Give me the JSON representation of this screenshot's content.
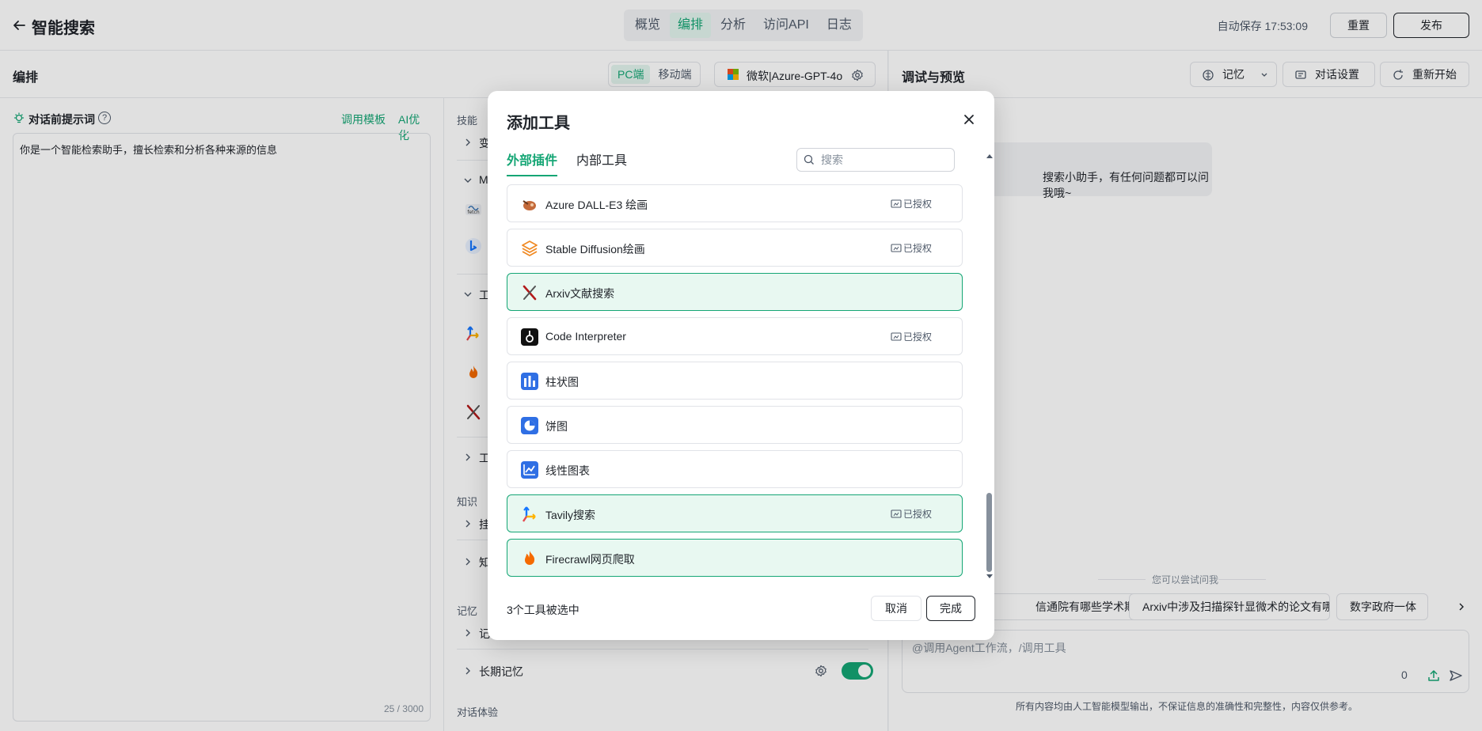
{
  "header": {
    "title": "智能搜索",
    "nav_tabs": [
      {
        "label": "概览"
      },
      {
        "label": "编排"
      },
      {
        "label": "分析"
      },
      {
        "label": "访问API"
      },
      {
        "label": "日志"
      }
    ],
    "active_tab": "编排",
    "autosave": "自动保存 17:53:09",
    "reset_label": "重置",
    "publish_label": "发布"
  },
  "editor": {
    "title": "编排",
    "device_pc": "PC端",
    "device_mobile": "移动端",
    "model_name": "微软|Azure-GPT-4o",
    "prompt_label": "对话前提示词",
    "template_link": "调用模板",
    "ai_optimize_link": "AI优化",
    "prompt_text": "你是一个智能检索助手，擅长检索和分析各种来源的信息",
    "char_count": "25 / 3000"
  },
  "skills": {
    "section_skills": "技能",
    "row_variables": "变",
    "row_mcp": "MC",
    "row_tools": "工",
    "row_workflow": "工",
    "section_knowledge": "知识",
    "row_mount": "挂",
    "row_knowledge": "知",
    "section_memory": "记忆",
    "row_memory_vars": "记忆变量",
    "row_long_memory": "长期记忆",
    "section_experience": "对话体验"
  },
  "preview": {
    "title": "调试与预览",
    "memory_btn": "记忆",
    "dialog_settings_btn": "对话设置",
    "restart_btn": "重新开始",
    "greeting": "搜索小助手，有任何问题都可以问我哦~",
    "try_label": "您可以尝试问我",
    "suggestions": [
      {
        "label": "信通院有哪些学术期刊?"
      },
      {
        "label": "Arxiv中涉及扫描探针显微术的论文有哪些?"
      },
      {
        "label": "数字政府一体"
      }
    ],
    "input_placeholder": "@调用Agent工作流，/调用工具",
    "input_count": "0",
    "disclaimer": "所有内容均由人工智能模型输出，不保证信息的准确性和完整性，内容仅供参考。"
  },
  "modal": {
    "title": "添加工具",
    "tab_external": "外部插件",
    "tab_internal": "内部工具",
    "search_placeholder": "搜索",
    "authorized_label": "已授权",
    "plugins": [
      {
        "name": "Azure DALL-E3 绘画",
        "icon": "dalle-icon",
        "authorized": true,
        "selected": false
      },
      {
        "name": "Stable Diffusion绘画",
        "icon": "stable-diffusion-icon",
        "authorized": true,
        "selected": false
      },
      {
        "name": "Arxiv文献搜索",
        "icon": "arxiv-icon",
        "authorized": false,
        "selected": true
      },
      {
        "name": "Code Interpreter",
        "icon": "code-interpreter-icon",
        "authorized": true,
        "selected": false
      },
      {
        "name": "柱状图",
        "icon": "bar-chart-icon",
        "authorized": false,
        "selected": false
      },
      {
        "name": "饼图",
        "icon": "pie-chart-icon",
        "authorized": false,
        "selected": false
      },
      {
        "name": "线性图表",
        "icon": "line-chart-icon",
        "authorized": false,
        "selected": false
      },
      {
        "name": "Tavily搜索",
        "icon": "tavily-icon",
        "authorized": true,
        "selected": true
      },
      {
        "name": "Firecrawl网页爬取",
        "icon": "firecrawl-icon",
        "authorized": false,
        "selected": true
      }
    ],
    "selected_count_text": "3个工具被选中",
    "cancel_label": "取消",
    "done_label": "完成"
  },
  "colors": {
    "accent": "#15a675",
    "selected_bg": "#e8f8f1"
  }
}
